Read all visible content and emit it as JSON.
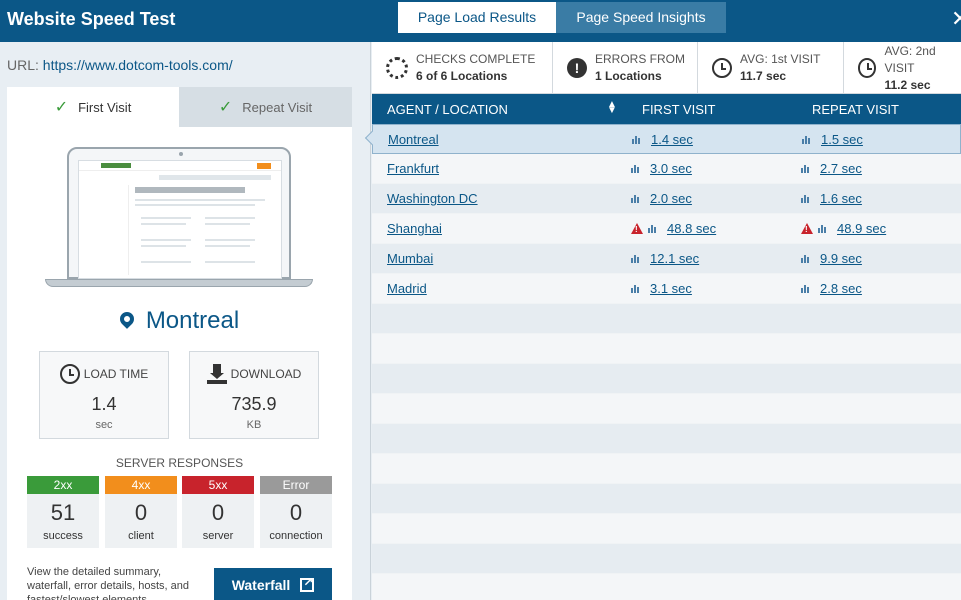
{
  "header": {
    "title": "Website Speed Test",
    "tabs": [
      {
        "label": "Page Load Results",
        "active": true
      },
      {
        "label": "Page Speed Insights",
        "active": false
      }
    ]
  },
  "left": {
    "url_label": "URL:",
    "url": "https://www.dotcom-tools.com/",
    "visit_tabs": [
      {
        "label": "First Visit",
        "active": true
      },
      {
        "label": "Repeat Visit",
        "active": false
      }
    ],
    "location": "Montreal",
    "load_time": {
      "label": "LOAD TIME",
      "value": "1.4",
      "unit": "sec"
    },
    "download": {
      "label": "DOWNLOAD",
      "value": "735.9",
      "unit": "KB"
    },
    "server_responses_title": "SERVER RESPONSES",
    "responses": [
      {
        "code": "2xx",
        "count": "51",
        "label": "success",
        "color": "#3a9b3a"
      },
      {
        "code": "4xx",
        "count": "0",
        "label": "client",
        "color": "#f28e1c"
      },
      {
        "code": "5xx",
        "count": "0",
        "label": "server",
        "color": "#c8232c"
      },
      {
        "code": "Error",
        "count": "0",
        "label": "connection",
        "color": "#9a9a9a"
      }
    ],
    "waterfall_text": "View the detailed summary, waterfall, error details, hosts, and fastest/slowest elements",
    "waterfall_button": "Waterfall"
  },
  "summary": {
    "checks_label": "CHECKS COMPLETE",
    "checks_value": "6 of 6 Locations",
    "errors_label": "ERRORS FROM",
    "errors_value": "1 Locations",
    "avg1_label": "AVG: 1st VISIT",
    "avg1_value": "11.7 sec",
    "avg2_label": "AVG: 2nd VISIT",
    "avg2_value": "11.2 sec"
  },
  "table": {
    "headers": [
      "AGENT / LOCATION",
      "FIRST VISIT",
      "REPEAT VISIT"
    ],
    "rows": [
      {
        "location": "Montreal",
        "first": "1.4 sec",
        "repeat": "1.5 sec",
        "warn": false,
        "selected": true
      },
      {
        "location": "Frankfurt",
        "first": "3.0 sec",
        "repeat": "2.7 sec",
        "warn": false,
        "selected": false
      },
      {
        "location": "Washington DC",
        "first": "2.0 sec",
        "repeat": "1.6 sec",
        "warn": false,
        "selected": false
      },
      {
        "location": "Shanghai",
        "first": "48.8 sec",
        "repeat": "48.9 sec",
        "warn": true,
        "selected": false
      },
      {
        "location": "Mumbai",
        "first": "12.1 sec",
        "repeat": "9.9 sec",
        "warn": false,
        "selected": false
      },
      {
        "location": "Madrid",
        "first": "3.1 sec",
        "repeat": "2.8 sec",
        "warn": false,
        "selected": false
      }
    ]
  },
  "icons": {
    "spinner": "spinner-icon",
    "error": "exclamation-circle-icon",
    "clock": "clock-icon",
    "bar": "bar-chart-icon",
    "warn": "warning-triangle-icon"
  }
}
